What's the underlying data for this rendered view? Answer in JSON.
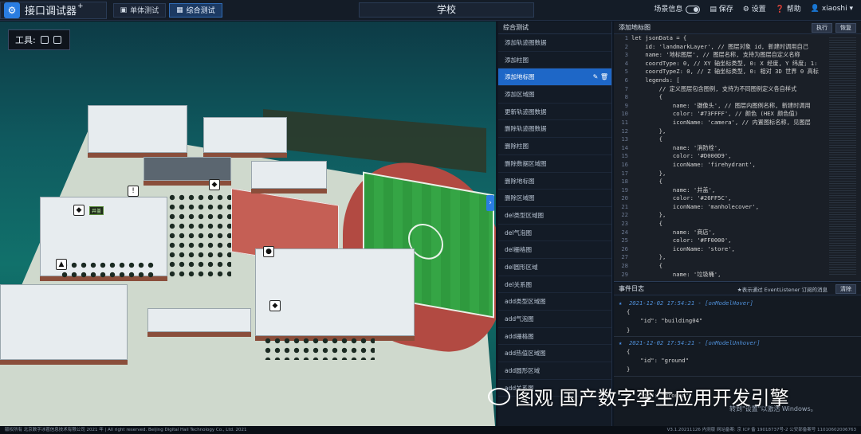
{
  "app": {
    "title": "接口调试器",
    "title_sup": "+",
    "logo_glyph": "⚙"
  },
  "modes": [
    {
      "label": "单体测试",
      "icon": "cube-icon",
      "active": false
    },
    {
      "label": "综合测试",
      "icon": "cubes-icon",
      "active": true
    }
  ],
  "center_title": "学校",
  "right_tools": {
    "scene_info": "场景信息",
    "save": "保存",
    "settings": "设置",
    "help": "帮助",
    "user": "xiaoshi"
  },
  "scene": {
    "tools_label": "工具:",
    "expander": "›"
  },
  "list": {
    "header": "综合测试",
    "items": [
      "添加轨迹图数据",
      "添加柱图",
      "添加地标图",
      "添加区域图",
      "更新轨迹图数据",
      "删除轨迹图数据",
      "删除柱图",
      "删除数据区域图",
      "删除地标图",
      "删除区域图",
      "del类型区域图",
      "del气泡图",
      "del栅格图",
      "del圆形区域",
      "del关系图",
      "add类型区域图",
      "add气泡图",
      "add栅格图",
      "add热值区域图",
      "add圆形区域",
      "add关系图"
    ],
    "active_index": 2
  },
  "code": {
    "header": "添加地标图",
    "run": "执行",
    "reset": "恢复",
    "lines": [
      [
        "let jsonData = {"
      ],
      [
        "    id: 'landmarkLayer', // 图层对象 id, 新建时调用自己"
      ],
      [
        "    name: '地标图层', // 图层名称, 支持为图层自定义名称"
      ],
      [
        "    coordType: 0, // XY 轴坐标类型, 0: X 经度, Y 纬度; 1:"
      ],
      [
        "    coordTypeZ: 0, // Z 轴坐标类型, 0: 相对 3D 世界 0 高标"
      ],
      [
        "    legends: ["
      ],
      [
        "        // 定义图层包含图例, 支持为不同图例定义各自样式"
      ],
      [
        "        {"
      ],
      [
        "            name: '摄像头', // 图层内图例名称, 新建时调用"
      ],
      [
        "            color: '#73FFFF', // 颜色 (HEX 颜色值)"
      ],
      [
        "            iconName: 'camera', // 内置图标名称, 见图层"
      ],
      [
        "        },"
      ],
      [
        "        {"
      ],
      [
        "            name: '消防栓',"
      ],
      [
        "            color: '#D000D9',"
      ],
      [
        "            iconName: 'firehydrant',"
      ],
      [
        "        },"
      ],
      [
        "        {"
      ],
      [
        "            name: '井盖',"
      ],
      [
        "            color: '#26FF5C',"
      ],
      [
        "            iconName: 'manholecover',"
      ],
      [
        "        },"
      ],
      [
        "        {"
      ],
      [
        "            name: '商店',"
      ],
      [
        "            color: '#FF0000',"
      ],
      [
        "            iconName: 'store',"
      ],
      [
        "        },"
      ],
      [
        "        {"
      ],
      [
        "            name: '垃圾桶',"
      ]
    ]
  },
  "log": {
    "header": "事件日志",
    "hint": "★表示通过 EventListener 订阅的消息",
    "clear": "清除",
    "entries": [
      {
        "time": "2021-12-02 17:54:21 - [onModelHover]",
        "open": "{",
        "body": "    \"id\": \"building04\"",
        "close": "}"
      },
      {
        "time": "2021-12-02 17:54:21 - [onModelUnhover]",
        "open": "{",
        "body": "    \"id\": \"ground\"",
        "close": "}"
      }
    ],
    "tail": "    \"id\": \"ground\""
  },
  "watermark": {
    "text": "图观 国产数字孪生应用开发引擎"
  },
  "windows_hint": "转到\"设置\"以激活 Windows。",
  "footer": {
    "left": "版权所有 北京数字冰雹信息技术有限公司 2021 年 | All right reserved. Beijing Digital Hail Technology Co., Ltd. 2021",
    "right": "V3.1.20211126 内测版 网站备案: 京 ICP 备 19018737号-2 公安部备案号 11010602006763"
  },
  "pins": [
    {
      "glyph": "!",
      "label": ""
    },
    {
      "glyph": "◆",
      "label": ""
    },
    {
      "glyph": "◆",
      "label": "井盖"
    },
    {
      "glyph": "▲",
      "label": ""
    },
    {
      "glyph": "●",
      "label": ""
    },
    {
      "glyph": "◆",
      "label": ""
    }
  ],
  "colors": {
    "accent": "#1e67c7",
    "bg": "#0e1621"
  }
}
